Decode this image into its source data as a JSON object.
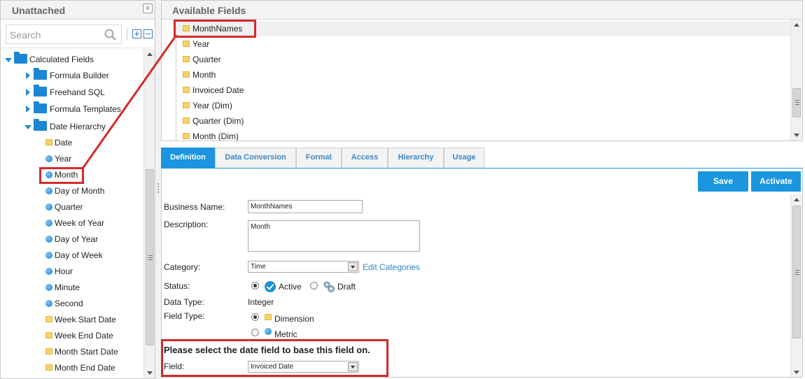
{
  "left_panel": {
    "title": "Unattached",
    "search_placeholder": "Search",
    "tree": {
      "root": "Calculated Fields",
      "folders": [
        "Formula Builder",
        "Freehand SQL",
        "Formula Templates",
        "Date Hierarchy"
      ],
      "date_hierarchy_items": [
        {
          "label": "Date",
          "icon": "folder-icon"
        },
        {
          "label": "Year",
          "icon": "dot-icon"
        },
        {
          "label": "Month",
          "icon": "dot-icon"
        },
        {
          "label": "Day of Month",
          "icon": "dot-icon"
        },
        {
          "label": "Quarter",
          "icon": "dot-icon"
        },
        {
          "label": "Week of Year",
          "icon": "dot-icon"
        },
        {
          "label": "Day of Year",
          "icon": "dot-icon"
        },
        {
          "label": "Day of Week",
          "icon": "dot-icon"
        },
        {
          "label": "Hour",
          "icon": "dot-icon"
        },
        {
          "label": "Minute",
          "icon": "dot-icon"
        },
        {
          "label": "Second",
          "icon": "dot-icon"
        },
        {
          "label": "Week Start Date",
          "icon": "folder-icon"
        },
        {
          "label": "Week End Date",
          "icon": "folder-icon"
        },
        {
          "label": "Month Start Date",
          "icon": "folder-icon"
        },
        {
          "label": "Month End Date",
          "icon": "folder-icon"
        }
      ]
    }
  },
  "available_fields": {
    "title": "Available Fields",
    "items": [
      "MonthNames",
      "Year",
      "Quarter",
      "Month",
      "Invoiced Date",
      "Year (Dim)",
      "Quarter (Dim)",
      "Month (Dim)"
    ],
    "selected": "MonthNames"
  },
  "tabs": [
    "Definition",
    "Data Conversion",
    "Format",
    "Access",
    "Hierarchy",
    "Usage"
  ],
  "active_tab": "Definition",
  "form": {
    "save_label": "Save",
    "activate_label": "Activate",
    "business_name_label": "Business Name:",
    "business_name_value": "MonthNames",
    "description_label": "Description:",
    "description_value": "Month",
    "category_label": "Category:",
    "category_value": "Time",
    "edit_categories_label": "Edit Categories",
    "status_label": "Status:",
    "status_active": "Active",
    "status_draft": "Draft",
    "data_type_label": "Data Type:",
    "data_type_value": "Integer",
    "field_type_label": "Field Type:",
    "field_type_dimension": "Dimension",
    "field_type_metric": "Metric",
    "date_field_prompt": "Please select the date field to base this field on.",
    "field_label": "Field:",
    "field_value": "Invoiced Date"
  },
  "colors": {
    "accent": "#1b95e0",
    "annotation": "#d42a2a",
    "folder": "#f6d36a",
    "tree_folder": "#1b86d3"
  }
}
